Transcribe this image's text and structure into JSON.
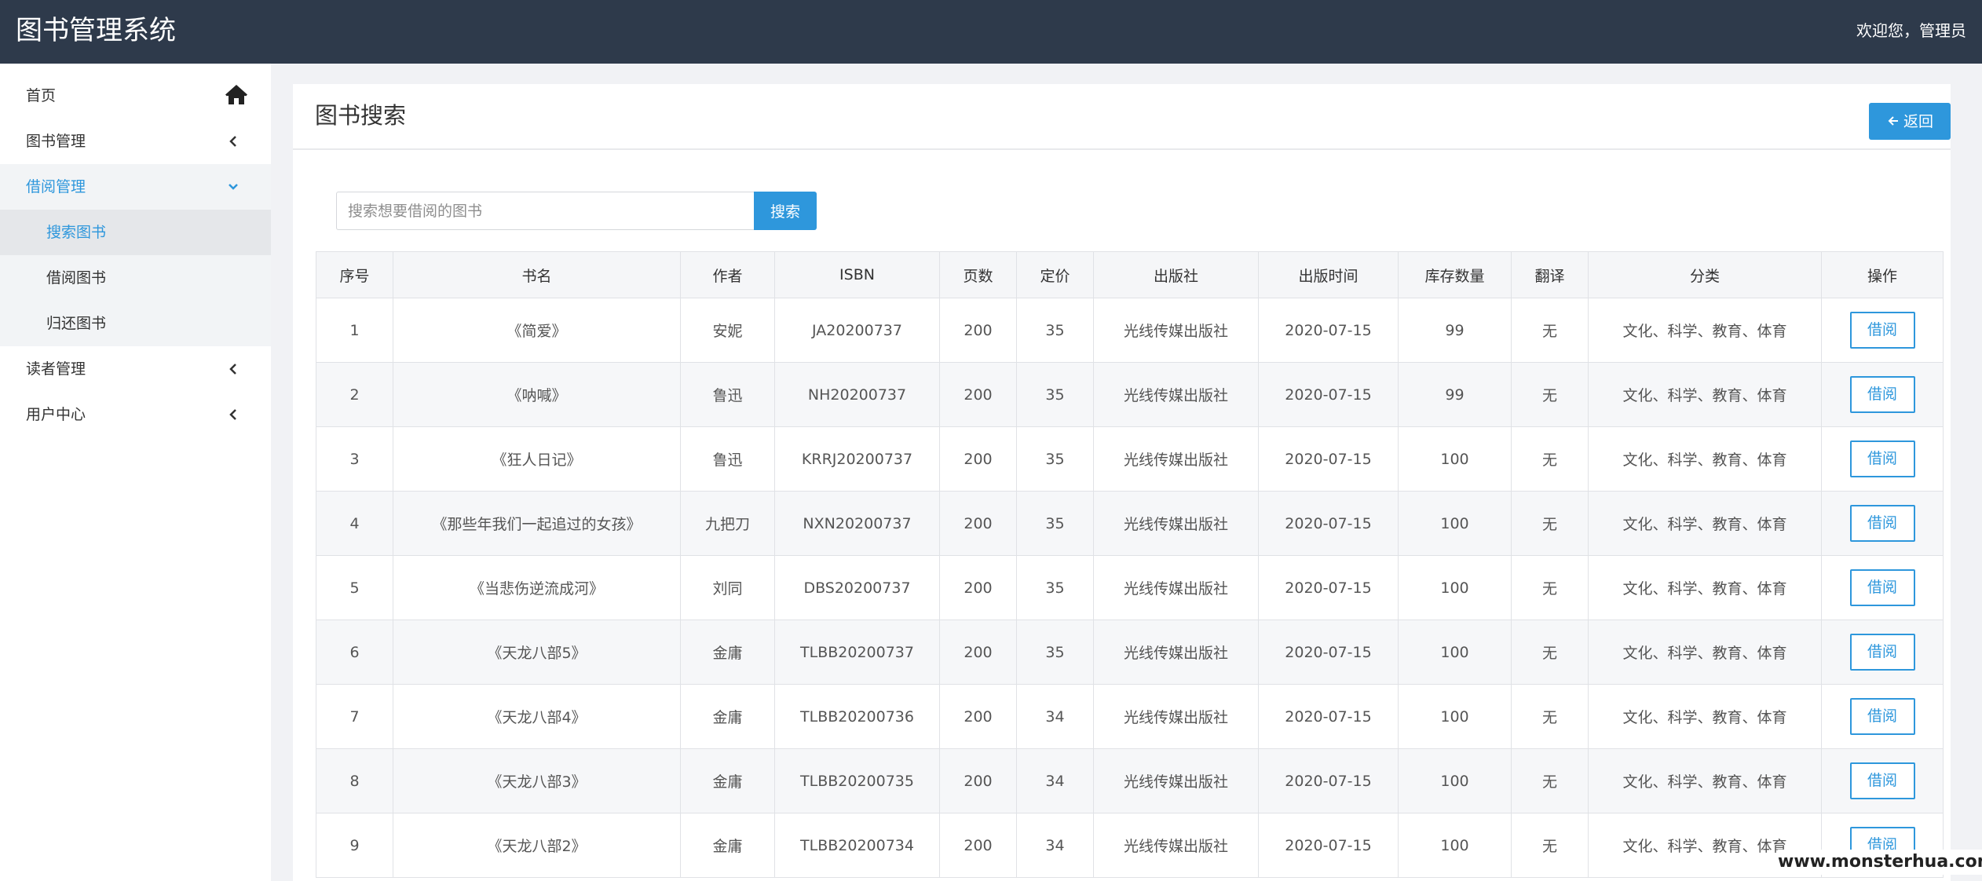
{
  "header": {
    "app_title": "图书管理系统",
    "welcome": "欢迎您，管理员"
  },
  "sidebar": {
    "items": [
      {
        "label": "首页",
        "icon": "home-icon"
      },
      {
        "label": "图书管理",
        "icon": "chevron-left-icon"
      },
      {
        "label": "借阅管理",
        "icon": "chevron-down-icon",
        "expanded": true
      },
      {
        "label": "搜索图书",
        "active": true
      },
      {
        "label": "借阅图书"
      },
      {
        "label": "归还图书"
      },
      {
        "label": "读者管理",
        "icon": "chevron-left-icon"
      },
      {
        "label": "用户中心",
        "icon": "chevron-left-icon"
      }
    ]
  },
  "main": {
    "title": "图书搜索",
    "back_label": "返回",
    "search": {
      "placeholder": "搜索想要借阅的图书",
      "value": "",
      "button_label": "搜索"
    },
    "table": {
      "headers": [
        "序号",
        "书名",
        "作者",
        "ISBN",
        "页数",
        "定价",
        "出版社",
        "出版时间",
        "库存数量",
        "翻译",
        "分类",
        "操作"
      ],
      "action_label": "借阅",
      "rows": [
        [
          "1",
          "《简爱》",
          "安妮",
          "JA20200737",
          "200",
          "35",
          "光线传媒出版社",
          "2020-07-15",
          "99",
          "无",
          "文化、科学、教育、体育"
        ],
        [
          "2",
          "《呐喊》",
          "鲁迅",
          "NH20200737",
          "200",
          "35",
          "光线传媒出版社",
          "2020-07-15",
          "99",
          "无",
          "文化、科学、教育、体育"
        ],
        [
          "3",
          "《狂人日记》",
          "鲁迅",
          "KRRJ20200737",
          "200",
          "35",
          "光线传媒出版社",
          "2020-07-15",
          "100",
          "无",
          "文化、科学、教育、体育"
        ],
        [
          "4",
          "《那些年我们一起追过的女孩》",
          "九把刀",
          "NXN20200737",
          "200",
          "35",
          "光线传媒出版社",
          "2020-07-15",
          "100",
          "无",
          "文化、科学、教育、体育"
        ],
        [
          "5",
          "《当悲伤逆流成河》",
          "刘同",
          "DBS20200737",
          "200",
          "35",
          "光线传媒出版社",
          "2020-07-15",
          "100",
          "无",
          "文化、科学、教育、体育"
        ],
        [
          "6",
          "《天龙八部5》",
          "金庸",
          "TLBB20200737",
          "200",
          "35",
          "光线传媒出版社",
          "2020-07-15",
          "100",
          "无",
          "文化、科学、教育、体育"
        ],
        [
          "7",
          "《天龙八部4》",
          "金庸",
          "TLBB20200736",
          "200",
          "34",
          "光线传媒出版社",
          "2020-07-15",
          "100",
          "无",
          "文化、科学、教育、体育"
        ],
        [
          "8",
          "《天龙八部3》",
          "金庸",
          "TLBB20200735",
          "200",
          "34",
          "光线传媒出版社",
          "2020-07-15",
          "100",
          "无",
          "文化、科学、教育、体育"
        ],
        [
          "9",
          "《天龙八部2》",
          "金庸",
          "TLBB20200734",
          "200",
          "34",
          "光线传媒出版社",
          "2020-07-15",
          "100",
          "无",
          "文化、科学、教育、体育"
        ]
      ]
    }
  },
  "watermark": "www.monsterhua.com",
  "colors": {
    "header_bg": "#2e3a4b",
    "accent": "#2e97dc",
    "page_bg": "#f1f2f5"
  }
}
